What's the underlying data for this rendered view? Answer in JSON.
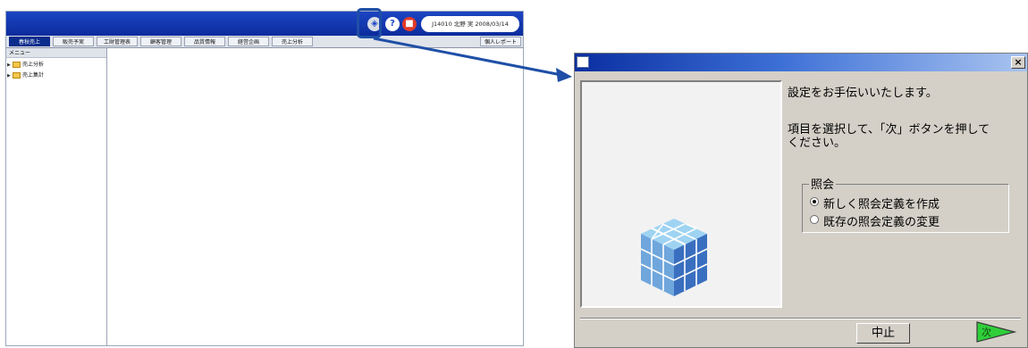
{
  "app": {
    "user_info": "J14010 北野 実  2008/03/14",
    "tabs": [
      "春秋売上",
      "販売予実",
      "工財管理表",
      "顧客管理",
      "品質情報",
      "経営企画",
      "売上分析"
    ],
    "report_tab": "個人レポート",
    "menu_title": "メニュー",
    "tree_items": [
      "売上分析",
      "売上集計"
    ]
  },
  "dialog": {
    "intro_text": "設定をお手伝いいたします。",
    "instruction_line1": "項目を選択して、「次」ボタンを押して",
    "instruction_line2": "ください。",
    "group_label": "照会",
    "options": [
      {
        "label": "新しく照会定義を作成",
        "selected": true
      },
      {
        "label": "既存の照会定義の変更",
        "selected": false
      }
    ],
    "cancel_label": "中止",
    "next_label": "次"
  },
  "colors": {
    "header_blue": "#0c2c9c",
    "highlight": "#1f4fa6",
    "dialog_face": "#d4d0c8",
    "next_arrow_fill": "#2fcf3a"
  },
  "icons": [
    "wizard-cube-icon",
    "help-icon",
    "exit-icon",
    "folder-icon",
    "close-icon",
    "next-arrow-icon"
  ]
}
